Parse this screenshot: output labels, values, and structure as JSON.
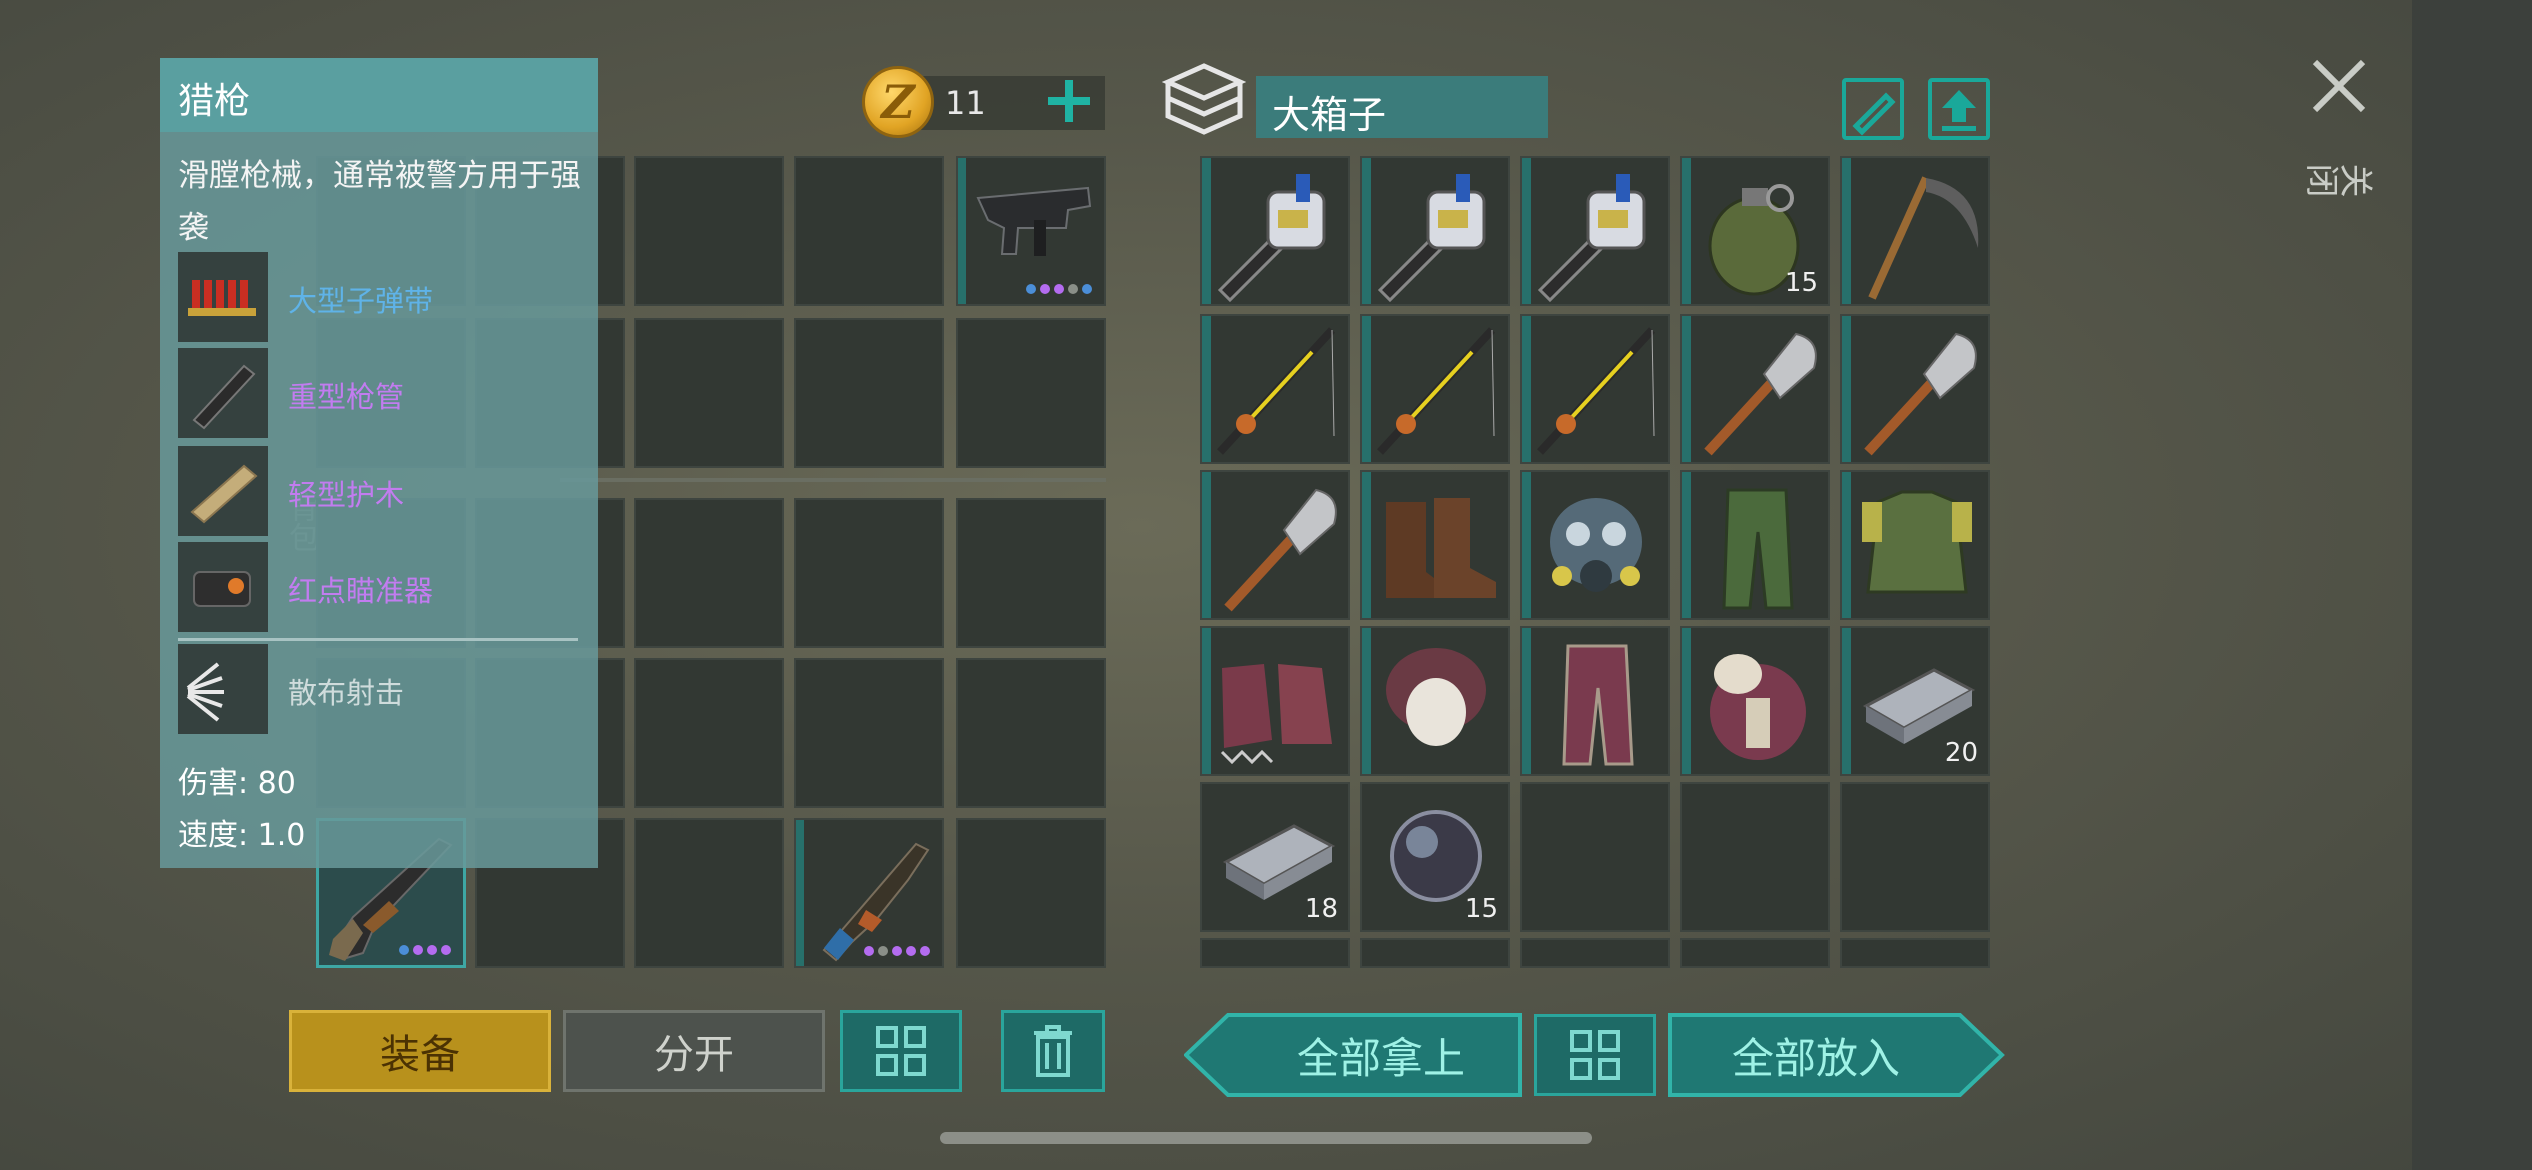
{
  "currency": {
    "icon": "z-coin-icon",
    "symbol": "Z",
    "amount": "11"
  },
  "backpack": {
    "vertical_label": "背包"
  },
  "tooltip": {
    "title": "猎枪",
    "description": "滑膛枪械，通常被警方用于强袭",
    "mods": [
      {
        "label": "大型子弹带",
        "icon": "shell-belt-icon",
        "color": "#5fb3e8"
      },
      {
        "label": "重型枪管",
        "icon": "heavy-barrel-icon",
        "color": "#c27cf0"
      },
      {
        "label": "轻型护木",
        "icon": "light-handguard-icon",
        "color": "#c27cf0"
      },
      {
        "label": "红点瞄准器",
        "icon": "red-dot-sight-icon",
        "color": "#c27cf0"
      }
    ],
    "perk": {
      "label": "散布射击",
      "icon": "spread-shot-icon"
    },
    "damage": "伤害: 80",
    "speed": "速度: 1.0"
  },
  "actions_left": {
    "equip": "装备",
    "split": "分开"
  },
  "chest": {
    "name": "大箱子",
    "take_all": "全部拿上",
    "put_all": "全部放入",
    "items": [
      {
        "icon": "drill-icon",
        "qty": ""
      },
      {
        "icon": "drill-icon",
        "qty": ""
      },
      {
        "icon": "drill-icon",
        "qty": ""
      },
      {
        "icon": "grenade-icon",
        "qty": "15"
      },
      {
        "icon": "scythe-icon",
        "qty": ""
      },
      {
        "icon": "fishing-rod-icon",
        "qty": ""
      },
      {
        "icon": "fishing-rod-icon",
        "qty": ""
      },
      {
        "icon": "fishing-rod-icon",
        "qty": ""
      },
      {
        "icon": "shovel-icon",
        "qty": ""
      },
      {
        "icon": "shovel-icon",
        "qty": ""
      },
      {
        "icon": "shovel-icon",
        "qty": ""
      },
      {
        "icon": "leather-boots-icon",
        "qty": ""
      },
      {
        "icon": "gas-mask-icon",
        "qty": ""
      },
      {
        "icon": "camo-pants-icon",
        "qty": ""
      },
      {
        "icon": "camo-vest-icon",
        "qty": ""
      },
      {
        "icon": "spiked-boots-icon",
        "qty": ""
      },
      {
        "icon": "fur-hat-icon",
        "qty": ""
      },
      {
        "icon": "fur-pants-icon",
        "qty": ""
      },
      {
        "icon": "fur-armor-icon",
        "qty": ""
      },
      {
        "icon": "iron-bar-icon",
        "qty": "20"
      },
      {
        "icon": "iron-bar-icon",
        "qty": "18"
      },
      {
        "icon": "lens-icon",
        "qty": "15"
      },
      {
        "icon": "",
        "qty": ""
      },
      {
        "icon": "",
        "qty": ""
      },
      {
        "icon": "",
        "qty": ""
      }
    ]
  },
  "close": {
    "label": "关闭"
  }
}
